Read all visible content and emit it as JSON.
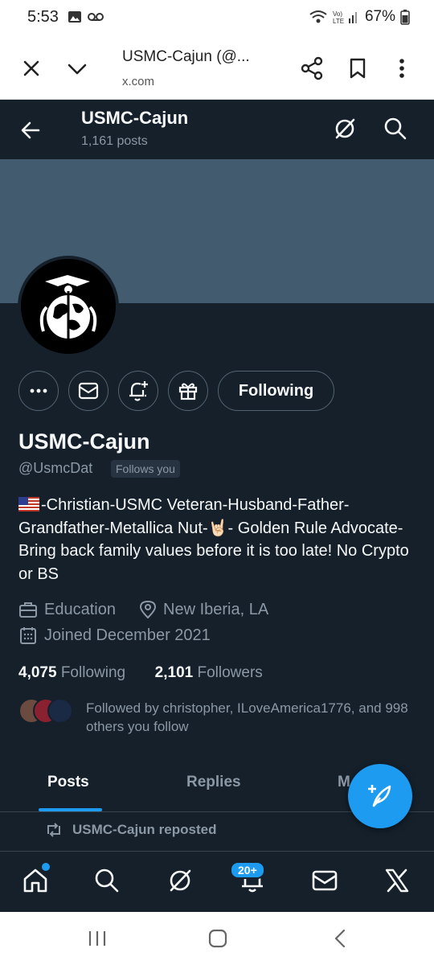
{
  "status_bar": {
    "time": "5:53",
    "battery": "67%"
  },
  "browser": {
    "title": "USMC-Cajun (@...",
    "url": "x.com"
  },
  "header": {
    "name": "USMC-Cajun",
    "posts": "1,161 posts"
  },
  "profile": {
    "following_button": "Following",
    "name": "USMC-Cajun",
    "handle": "@UsmcDat",
    "follows_you": "Follows you",
    "bio": "-Christian-USMC Veteran-Husband-Father-Grandfather-Metallica Nut-🤘🏻- Golden Rule Advocate-Bring back family values before it is too late! No Crypto or BS",
    "category": "Education",
    "location": "New Iberia, LA",
    "joined": "Joined December 2021",
    "following_count": "4,075",
    "following_label": "Following",
    "followers_count": "2,101",
    "followers_label": "Followers",
    "followed_by": "Followed by christopher, ILoveAmerica1776, and 998 others you follow"
  },
  "tabs": [
    "Posts",
    "Replies",
    "M"
  ],
  "repost_label": "USMC-Cajun reposted",
  "nav": {
    "notifications_badge": "20+"
  },
  "colors": {
    "background": "#15202b",
    "accent": "#1d9bf0",
    "banner": "#425b6e",
    "muted": "#8b98a5"
  }
}
